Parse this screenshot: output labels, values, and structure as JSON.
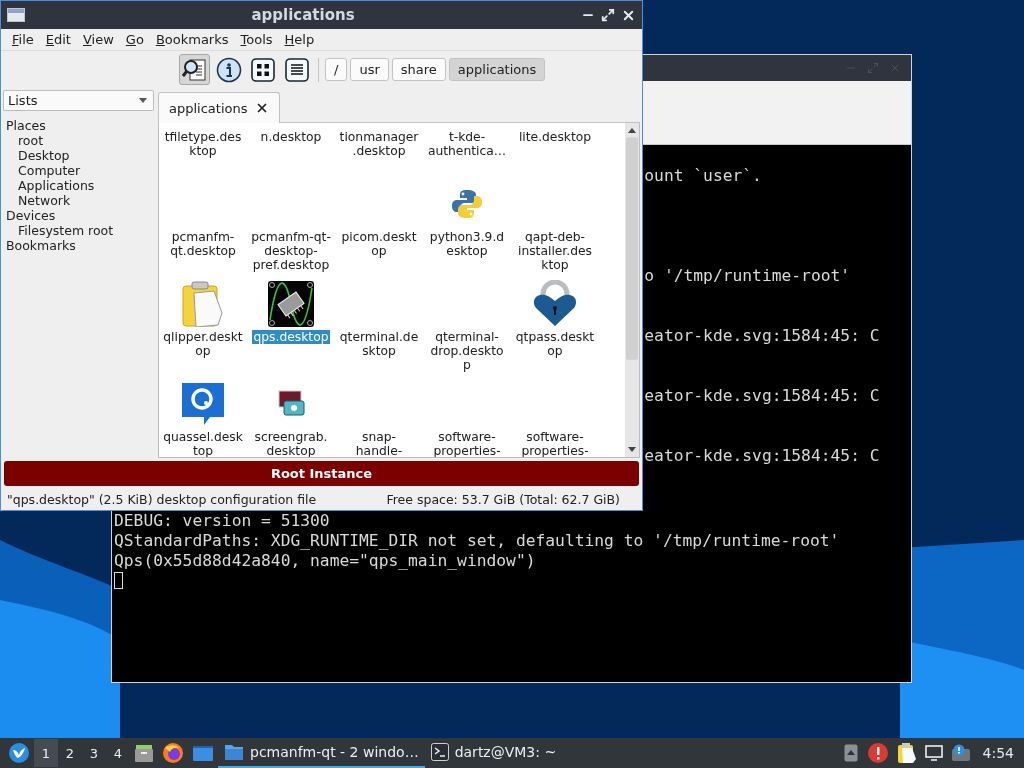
{
  "terminal_window": {
    "lines": [
      {
        "kind": "clipped",
        "text": "ount `user`."
      },
      {
        "kind": "clipped",
        "text": "o '/tmp/runtime-root'"
      },
      {
        "kind": "clipped",
        "text": "eator-kde.svg:1584:45: C"
      },
      {
        "kind": "clipped",
        "text": "eator-kde.svg:1584:45: C"
      },
      {
        "kind": "clipped",
        "text": "eator-kde.svg:1584:45: C"
      },
      {
        "kind": "full",
        "text": "DEBUG: version = 51300"
      },
      {
        "kind": "full",
        "text": "QStandardPaths: XDG_RUNTIME_DIR not set, defaulting to '/tmp/runtime-root'"
      },
      {
        "kind": "full",
        "text": "Qps(0x55d88d42a840, name=\"qps_main_window\")"
      },
      {
        "kind": "cursor"
      }
    ]
  },
  "file_manager": {
    "title": "applications",
    "menu": [
      "File",
      "Edit",
      "View",
      "Go",
      "Bookmarks",
      "Tools",
      "Help"
    ],
    "toolbar": [
      {
        "kind": "preview",
        "pressed": true
      },
      {
        "kind": "info",
        "pressed": false
      },
      {
        "kind": "grid",
        "pressed": false
      },
      {
        "kind": "list",
        "pressed": false
      }
    ],
    "path": [
      {
        "label": "/",
        "selected": false
      },
      {
        "label": "usr",
        "selected": false
      },
      {
        "label": "share",
        "selected": false
      },
      {
        "label": "applications",
        "selected": true
      }
    ],
    "side_dropdown": {
      "value": "Lists"
    },
    "places_tree": [
      {
        "label": "Places",
        "children": [
          {
            "label": "root"
          },
          {
            "label": "Desktop"
          },
          {
            "label": "Computer"
          },
          {
            "label": "Applications"
          },
          {
            "label": "Network"
          }
        ]
      },
      {
        "label": "Devices",
        "children": [
          {
            "label": "Filesystem root"
          }
        ]
      },
      {
        "label": "Bookmarks"
      }
    ],
    "tabs": [
      {
        "label": "applications",
        "selected": true
      }
    ],
    "files": [
      {
        "label_lines": [
          "tfiletype.des",
          "ktop"
        ],
        "selected": false
      },
      {
        "label_lines": [
          "n.desktop"
        ],
        "selected": false
      },
      {
        "label_lines": [
          "tionmanager",
          ".desktop"
        ],
        "selected": false
      },
      {
        "label_lines": [
          "t-kde-",
          "authentica…"
        ],
        "selected": false
      },
      {
        "label_lines": [
          "lite.desktop"
        ],
        "selected": false
      },
      {
        "label_lines": [
          "pcmanfm-",
          "qt.desktop"
        ],
        "selected": false
      },
      {
        "label_lines": [
          "pcmanfm-qt-",
          "desktop-",
          "pref.desktop"
        ],
        "selected": false
      },
      {
        "label_lines": [
          "picom.deskt",
          "op"
        ],
        "selected": false
      },
      {
        "label_lines": [
          "python3.9.d",
          "esktop"
        ],
        "kind": "python",
        "selected": false
      },
      {
        "label_lines": [
          "qapt-deb-",
          "installer.des",
          "ktop"
        ],
        "selected": false
      },
      {
        "label_lines": [
          "qlipper.deskt",
          "op"
        ],
        "kind": "clipboard",
        "selected": false
      },
      {
        "label_lines": [
          "qps.desktop"
        ],
        "kind": "cpu",
        "selected": true
      },
      {
        "label_lines": [
          "qterminal.de",
          "sktop"
        ],
        "selected": false
      },
      {
        "label_lines": [
          "qterminal-",
          "drop.deskto",
          "p"
        ],
        "selected": false
      },
      {
        "label_lines": [
          "qtpass.deskt",
          "op"
        ],
        "kind": "heart-lock",
        "selected": false
      },
      {
        "label_lines": [
          "quassel.desk",
          "top"
        ],
        "kind": "chat",
        "selected": false
      },
      {
        "label_lines": [
          "screengrab.",
          "desktop"
        ],
        "kind": "photo",
        "selected": false
      },
      {
        "label_lines": [
          "snap-",
          "handle-"
        ],
        "selected": false
      },
      {
        "label_lines": [
          "software-",
          "properties-"
        ],
        "selected": false
      },
      {
        "label_lines": [
          "software-",
          "properties-"
        ],
        "selected": false
      }
    ],
    "banner": "Root Instance",
    "status": {
      "left": "\"qps.desktop\" (2.5 KiB) desktop configuration file",
      "right": "Free space: 53.7 GiB (Total: 62.7 GiB)"
    }
  },
  "taskbar": {
    "desktops": [
      {
        "label": "1",
        "selected": true
      },
      {
        "label": "2",
        "selected": false
      },
      {
        "label": "3",
        "selected": false
      },
      {
        "label": "4",
        "selected": false
      }
    ],
    "launchers": [
      {
        "kind": "files"
      },
      {
        "kind": "browser"
      },
      {
        "kind": "window"
      }
    ],
    "tasks": [
      {
        "label": "pcmanfm-qt - 2 windo…",
        "kind": "folder",
        "selected": true
      },
      {
        "label": "dartz@VM3: ~",
        "kind": "terminal",
        "selected": false
      }
    ],
    "tray": [
      {
        "kind": "up"
      },
      {
        "kind": "alert"
      },
      {
        "kind": "clipboard"
      },
      {
        "kind": "monitor"
      },
      {
        "kind": "notice"
      }
    ],
    "clock": "4:54"
  }
}
